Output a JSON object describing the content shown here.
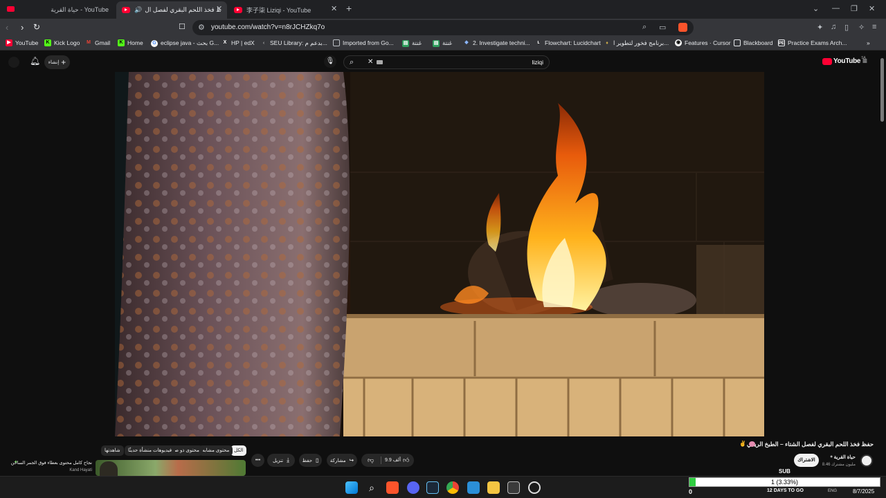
{
  "browser": {
    "tabs": [
      {
        "label": "حياة القرية - YouTube",
        "active": false
      },
      {
        "label": "حفظ فخذ اللحم البقري لفصل ال...",
        "active": true
      },
      {
        "label": "李子柒 Liziqi - YouTube",
        "active": false
      }
    ],
    "new_tab": "+",
    "url": "youtube.com/watch?v=n8rJCHZkq7o",
    "bookmarks": [
      {
        "label": "YouTube",
        "icon": "youtube-icon",
        "color": "#ff0033"
      },
      {
        "label": "Kick Logo",
        "icon": "kick-icon",
        "color": "#53fc18"
      },
      {
        "label": "Gmail",
        "icon": "gmail-icon",
        "color": "#ea4335"
      },
      {
        "label": "Home",
        "icon": "kick-icon",
        "color": "#53fc18"
      },
      {
        "label": "eclipse java - بحث G...",
        "icon": "google-icon",
        "color": "#ffffff"
      },
      {
        "label": "HP | edX",
        "icon": "edx-icon",
        "color": "#ffffff"
      },
      {
        "label": "SEU Library: بدعم م...",
        "icon": "library-icon",
        "color": "#777777"
      },
      {
        "label": "Imported from Go...",
        "icon": "folder-icon",
        "color": "#bdc1c6"
      },
      {
        "label": "غنتة",
        "icon": "sheet-icon",
        "color": "#2f9e5d"
      },
      {
        "label": "غنتة",
        "icon": "sheet-icon",
        "color": "#2f9e5d"
      },
      {
        "label": "2. Investigate techni...",
        "icon": "diamond-icon",
        "color": "#8ab4f8"
      },
      {
        "label": "Flowchart: Lucidchart",
        "icon": "lucid-icon",
        "color": "#ffffff"
      },
      {
        "label": "برنامج فخور لتطوير ا...",
        "icon": "crest-icon",
        "color": "#c8a94b"
      },
      {
        "label": "Features · Cursor",
        "icon": "cursor-icon",
        "color": "#ffffff"
      },
      {
        "label": "Blackboard",
        "icon": "blackboard-icon",
        "color": "#e8eaed"
      },
      {
        "label": "Practice Exams Arch...",
        "icon": "exam-icon",
        "color": "#e8eaed"
      }
    ],
    "bookmarks_more": "»"
  },
  "youtube": {
    "create_label": "إنشاء",
    "search_value": "liziqi",
    "logo_text": "YouTube",
    "logo_region": "SA",
    "video_title": "حفظ فخذ اللحم البقري لفصل الشتاء – الطبخ الريفي",
    "channel": {
      "name": "حياة القرية",
      "subscribers": "8.46 مليون مشترك"
    },
    "subscribe_label": "الاشتراك",
    "like_count": "9.9 ألف",
    "share_label": "مشاركة",
    "download_label": "تنزيل",
    "save_label": "حفظ",
    "more_label": "•••",
    "chips": [
      "الكل",
      "محتوى مشابه",
      "محتوى ذو صلة",
      "فيديوهات منشأة حديثًا",
      "شاهدتها"
    ],
    "recommendation": {
      "title": "نجاح كامل محتوى بعطاء فوق الجمر الساخن",
      "channel": "Kand Hayati"
    }
  },
  "overlay": {
    "sub_label": "SUB",
    "progress_text": "1 (3.33%)",
    "progress_value": 0.0333,
    "counter_left": "0",
    "countdown": "12 DAYS TO GO",
    "date": "8/7/2025",
    "tray_text": "ENG"
  },
  "colors": {
    "accent_red": "#ff0033",
    "progress_green": "#2ecc40",
    "chrome_bg": "#202124",
    "yt_bg": "#0f0f0f"
  }
}
